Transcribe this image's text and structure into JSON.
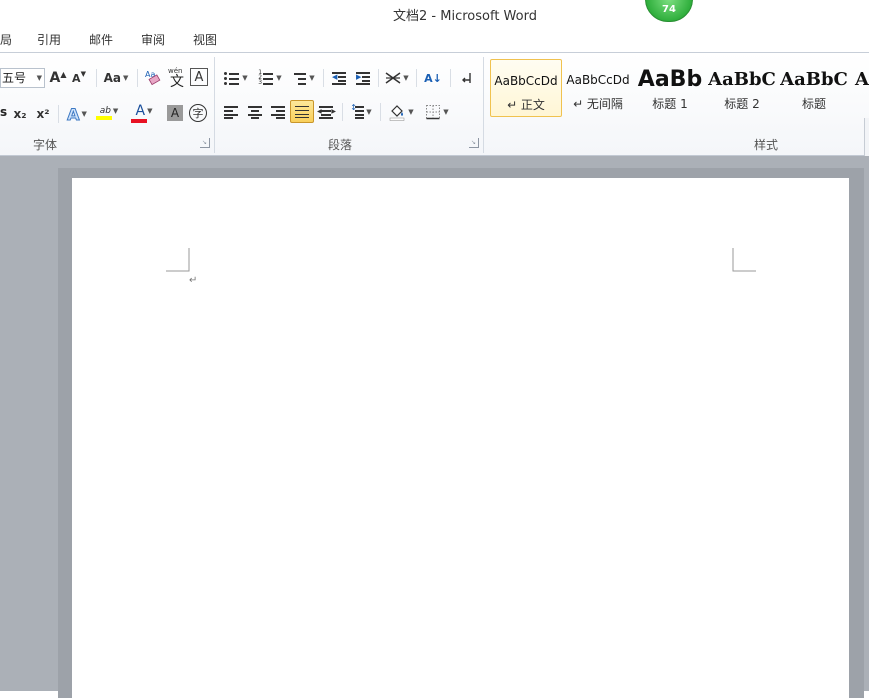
{
  "window": {
    "title": "文档2 - Microsoft Word",
    "badge_count": "74"
  },
  "tabs": [
    "局",
    "引用",
    "邮件",
    "审阅",
    "视图"
  ],
  "font_group": {
    "font_size": "五号",
    "grow_label": "A",
    "shrink_label": "A",
    "change_case_label": "Aa",
    "phonetic_label": "文",
    "border_char_label": "A",
    "subscript_label": "x₂",
    "superscript_label": "x²",
    "text_effect_label": "A",
    "highlight_label": "ab",
    "font_color_label": "A",
    "char_shading_label": "A",
    "enclose_char_label": "字",
    "highlight_color": "#ffff00",
    "font_color": "#e81123",
    "label": "字体"
  },
  "paragraph_group": {
    "sort_label": "A↓",
    "label": "段落"
  },
  "styles_group": {
    "label": "样式",
    "items": [
      {
        "sample": "AaBbCcDd",
        "name": "↵ 正文",
        "active": true
      },
      {
        "sample": "AaBbCcDd",
        "name": "↵ 无间隔",
        "active": false
      },
      {
        "sample": "AaBb",
        "name": "标题 1",
        "active": false
      },
      {
        "sample": "AaBbC",
        "name": "标题 2",
        "active": false
      },
      {
        "sample": "AaBbC",
        "name": "标题",
        "active": false
      },
      {
        "sample": "A",
        "name": "",
        "active": false
      }
    ]
  },
  "document": {
    "paragraph_mark": "↵"
  }
}
